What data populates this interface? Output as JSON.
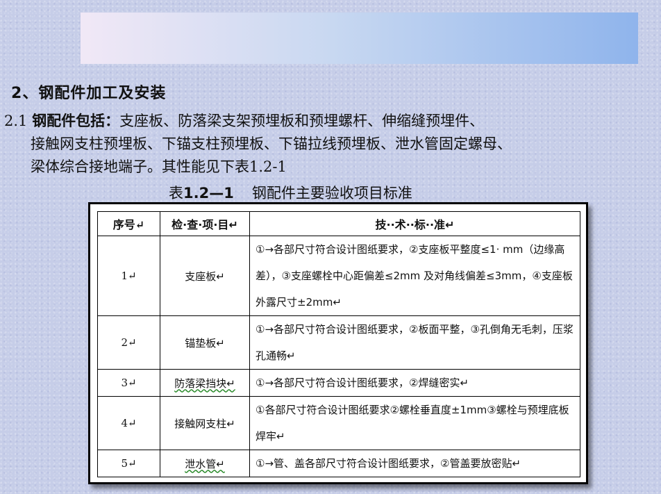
{
  "section": {
    "number": "2",
    "title": "、钢配件加工及安装"
  },
  "paragraph": {
    "prefix": "2.1 ",
    "lead": "钢配件包括：",
    "line1": "支座板、防落梁支架预埋板和预埋螺杆、伸缩缝预埋件、",
    "line2": "接触网支柱预埋板、下锚支柱预埋板、下锚拉线预埋板、泄水管固定螺母、",
    "line3": "梁体综合接地端子。其性能见下表1.2-1"
  },
  "caption": {
    "prefix": "表",
    "number": "1.2—1",
    "title": "钢配件主要验收项目标准"
  },
  "table": {
    "headers": [
      "序号↵",
      "检·查·项·目↵",
      "技··术··标··准↵"
    ],
    "rows": [
      {
        "idx": "1↵",
        "item": "支座板↵",
        "standard": "①→各部尺寸符合设计图纸要求，②支座板平整度≤1· mm（边缘高差），③支座螺栓中心距偏差≤2mm 及对角线偏差≤3mm，④支座板外露尺寸±2mm↵"
      },
      {
        "idx": "2↵",
        "item": "锚垫板↵",
        "standard": "①→各部尺寸符合设计图纸要求，②板面平整，③孔倒角无毛刺，压浆孔通畅↵"
      },
      {
        "idx": "3↵",
        "item": "防落梁挡块↵",
        "standard": "①→各部尺寸符合设计图纸要求，②焊缝密实↵"
      },
      {
        "idx": "4↵",
        "item": "接触网支柱↵",
        "standard": "①各部尺寸符合设计图纸要求②螺栓垂直度±1mm③螺栓与预埋底板焊牢↵"
      },
      {
        "idx": "5↵",
        "item": "泄水管↵",
        "standard": "①→管、盖各部尺寸符合设计图纸要求，②管盖要放密贴↵"
      }
    ]
  }
}
